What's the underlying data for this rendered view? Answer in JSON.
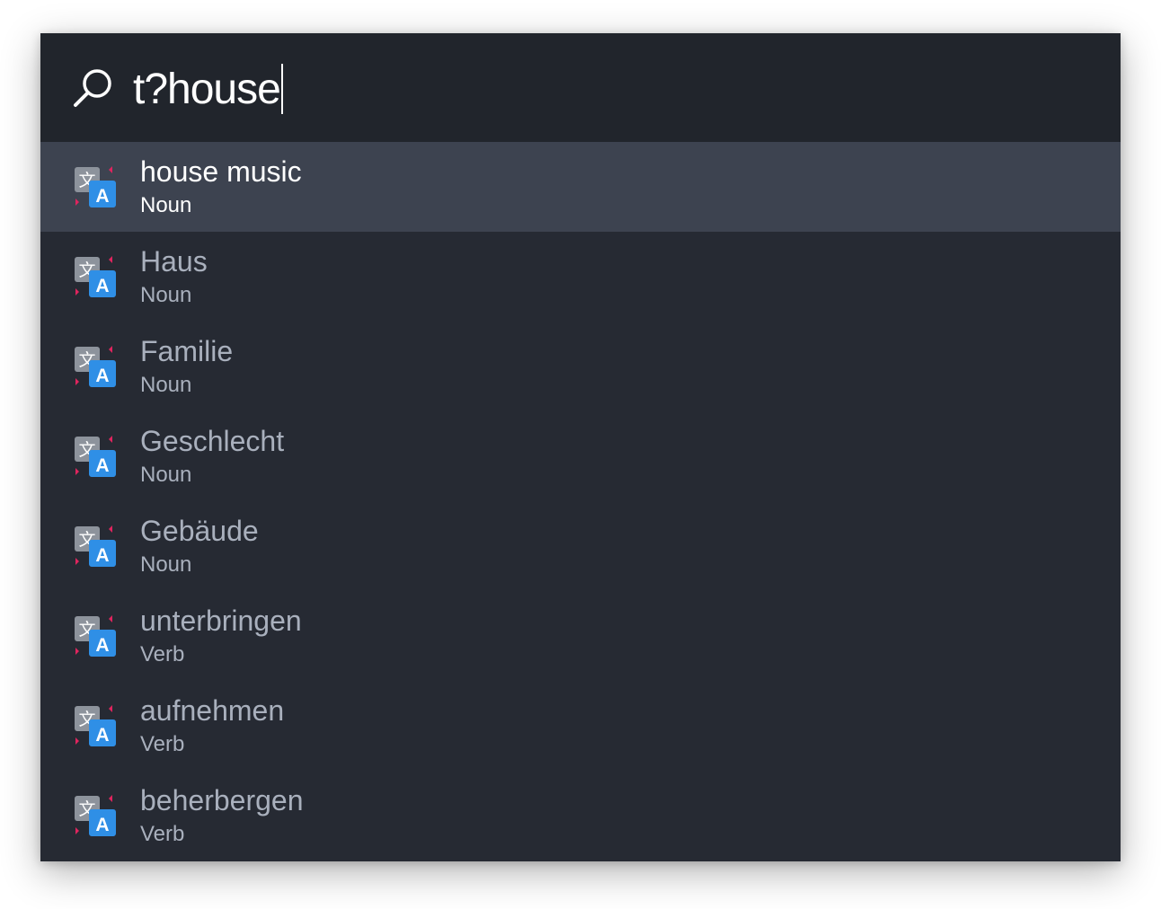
{
  "search": {
    "query": "t?house",
    "icon": "magnifier-icon"
  },
  "results": [
    {
      "title": "house music",
      "subtitle": "Noun",
      "icon": "translate-icon",
      "selected": true
    },
    {
      "title": "Haus",
      "subtitle": "Noun",
      "icon": "translate-icon",
      "selected": false
    },
    {
      "title": "Familie",
      "subtitle": "Noun",
      "icon": "translate-icon",
      "selected": false
    },
    {
      "title": "Geschlecht",
      "subtitle": "Noun",
      "icon": "translate-icon",
      "selected": false
    },
    {
      "title": "Gebäude",
      "subtitle": "Noun",
      "icon": "translate-icon",
      "selected": false
    },
    {
      "title": "unterbringen",
      "subtitle": "Verb",
      "icon": "translate-icon",
      "selected": false
    },
    {
      "title": "aufnehmen",
      "subtitle": "Verb",
      "icon": "translate-icon",
      "selected": false
    },
    {
      "title": "beherbergen",
      "subtitle": "Verb",
      "icon": "translate-icon",
      "selected": false
    }
  ],
  "colors": {
    "background": "#262a33",
    "search_background": "#21252c",
    "selected_row": "#3d4350",
    "text_dim": "#a9b0bd",
    "text_bright": "#ffffff",
    "icon_blue": "#2f8fe6",
    "icon_grey": "#8d939c",
    "icon_accent": "#e0245e"
  }
}
